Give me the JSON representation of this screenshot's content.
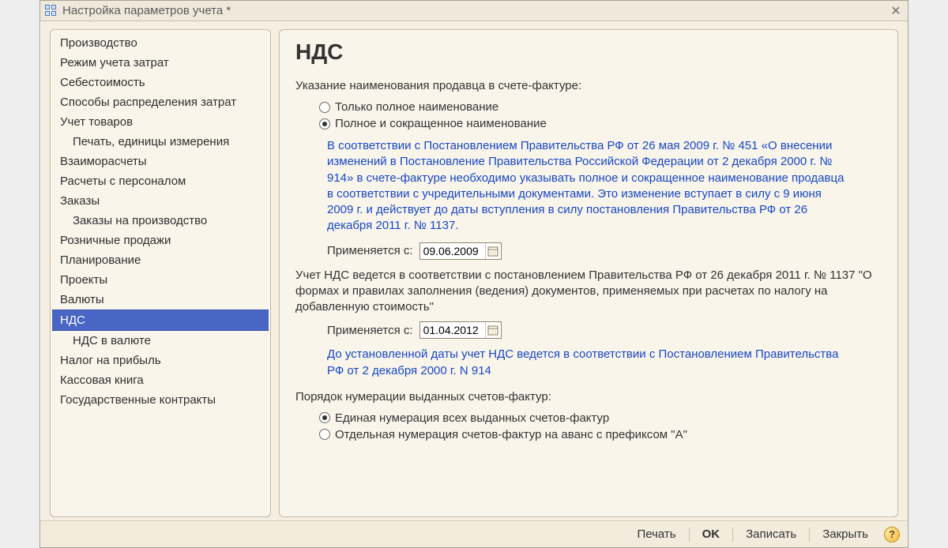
{
  "window": {
    "title": "Настройка параметров учета *"
  },
  "sidebar": {
    "items": [
      {
        "label": "Производство",
        "indent": false
      },
      {
        "label": "Режим учета затрат",
        "indent": false
      },
      {
        "label": "Себестоимость",
        "indent": false
      },
      {
        "label": "Способы распределения затрат",
        "indent": false
      },
      {
        "label": "Учет товаров",
        "indent": false
      },
      {
        "label": "Печать, единицы измерения",
        "indent": true
      },
      {
        "label": "Взаиморасчеты",
        "indent": false
      },
      {
        "label": "Расчеты с персоналом",
        "indent": false
      },
      {
        "label": "Заказы",
        "indent": false
      },
      {
        "label": "Заказы на производство",
        "indent": true
      },
      {
        "label": "Розничные продажи",
        "indent": false
      },
      {
        "label": "Планирование",
        "indent": false
      },
      {
        "label": "Проекты",
        "indent": false
      },
      {
        "label": "Валюты",
        "indent": false
      },
      {
        "label": "НДС",
        "indent": false,
        "selected": true
      },
      {
        "label": "НДС в валюте",
        "indent": true
      },
      {
        "label": "Налог на прибыль",
        "indent": false
      },
      {
        "label": "Кассовая книга",
        "indent": false
      },
      {
        "label": "Государственные контракты",
        "indent": false
      }
    ]
  },
  "content": {
    "heading": "НДС",
    "seller_name_label": "Указание наименования продавца в счете-фактуре:",
    "radio1": "Только полное наименование",
    "radio2": "Полное и сокращенное наименование",
    "note1": "В соответствии с Постановлением Правительства РФ от 26 мая 2009 г. № 451 «О внесении изменений в Постановление Правительства Российской Федерации от 2 декабря 2000 г. № 914» в счете-фактуре необходимо указывать полное и сокращенное наименование продавца в соответствии с учредительными документами. Это изменение вступает в силу с 9 июня 2009 г. и действует до даты вступления в силу постановления Правительства РФ от 26 декабря 2011 г. № 1137.",
    "applies_from_label": "Применяется с:",
    "date1": "09.06.2009",
    "para2": "Учет НДС ведется в соответствии с постановлением Правительства РФ от 26 декабря 2011 г. № 1137 \"О формах и правилах заполнения (ведения) документов, применяемых при расчетах по налогу на добавленную стоимость\"",
    "date2": "01.04.2012",
    "note2": "До установленной даты учет НДС ведется в соответствии с Постановлением Правительства РФ от 2 декабря 2000 г. N 914",
    "numbering_label": "Порядок нумерации выданных счетов-фактур:",
    "num_radio1": "Единая нумерация всех выданных счетов-фактур",
    "num_radio2": "Отдельная нумерация счетов-фактур на аванс с префиксом \"А\""
  },
  "footer": {
    "print": "Печать",
    "ok": "OK",
    "save": "Записать",
    "close": "Закрыть"
  }
}
